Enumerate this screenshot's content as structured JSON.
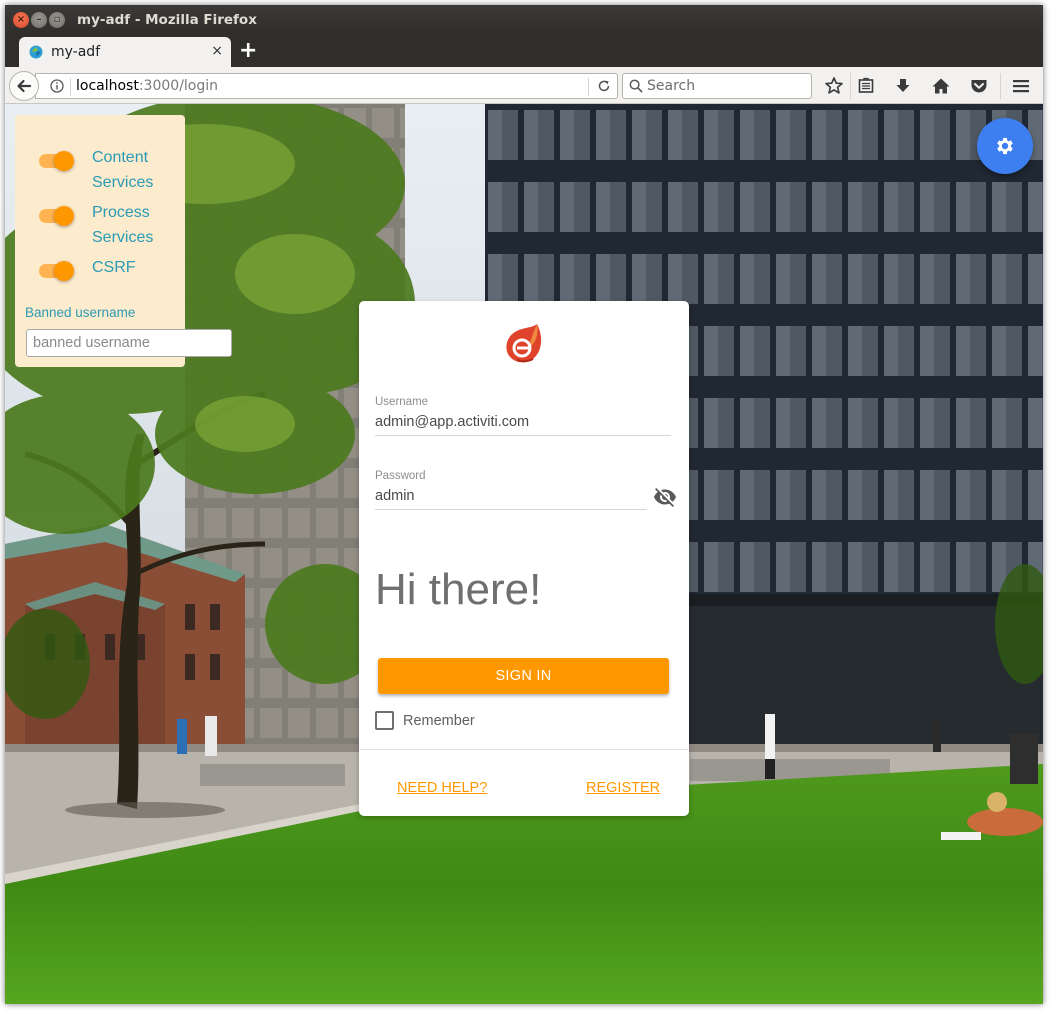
{
  "window": {
    "title": "my-adf - Mozilla Firefox"
  },
  "tab": {
    "label": "my-adf",
    "close_glyph": "×",
    "new_tab_glyph": "+"
  },
  "navbar": {
    "url_host": "localhost",
    "url_rest": ":3000/login",
    "search_placeholder": "Search",
    "icons": [
      "back-icon",
      "info-icon",
      "reload-icon",
      "search-icon",
      "bookmark-star-icon",
      "reading-list-icon",
      "download-icon",
      "home-icon",
      "pocket-icon",
      "hamburger-menu-icon"
    ]
  },
  "settings": {
    "toggles": [
      {
        "label": "Content Services",
        "on": true
      },
      {
        "label": "Process Services",
        "on": true
      },
      {
        "label": "CSRF",
        "on": true
      }
    ],
    "banned_label": "Banned username",
    "banned_placeholder": "banned username",
    "accent_color": "#ff9800",
    "label_color": "#2a9bb5"
  },
  "login": {
    "username_label": "Username",
    "username_value": "admin@app.activiti.com",
    "password_label": "Password",
    "password_value": "admin",
    "greeting": "Hi there!",
    "signin_label": "SIGN IN",
    "remember_label": "Remember",
    "remember_checked": false,
    "need_help": "NEED HELP?",
    "register": "REGISTER",
    "accent_color": "#ff9800"
  },
  "fab": {
    "icon": "gear-icon",
    "color": "#3d7ef0"
  }
}
